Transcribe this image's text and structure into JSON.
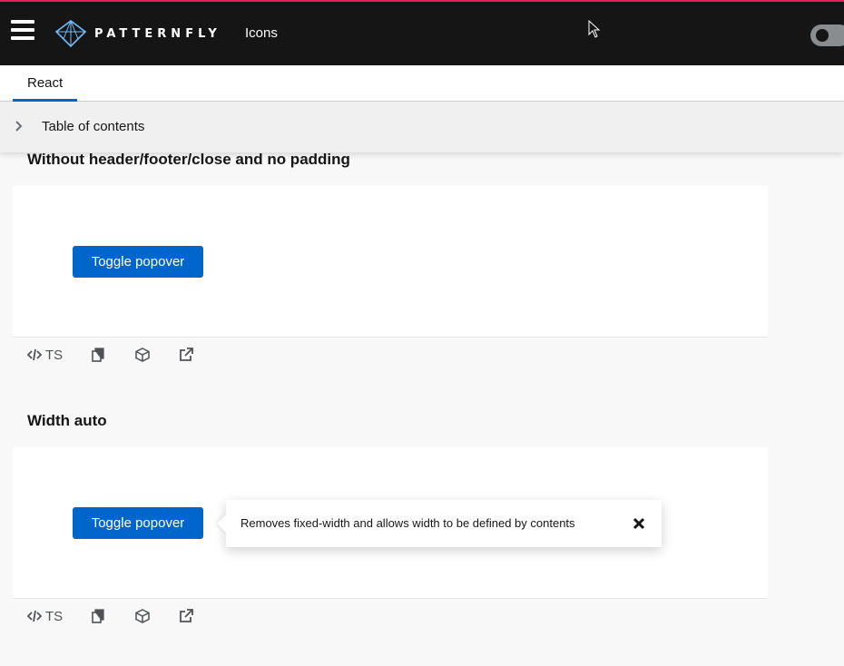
{
  "header": {
    "brand": "PATTERNFLY",
    "nav_link": "Icons",
    "menu_icon": "hamburger-icon",
    "logo_icon": "patternfly-logo-icon",
    "theme_toggle_icon": "theme-toggle"
  },
  "tabs": [
    {
      "label": "React",
      "active": true
    }
  ],
  "toc": {
    "label": "Table of contents",
    "icon": "chevron-right-icon"
  },
  "sections": [
    {
      "title": "Without header/footer/close and no padding",
      "button_label": "Toggle popover",
      "toolbar": {
        "ts_label": "TS",
        "icons": [
          "code-icon",
          "copy-icon",
          "codesandbox-icon",
          "external-link-icon"
        ]
      }
    },
    {
      "title": "Width auto",
      "button_label": "Toggle popover",
      "toolbar": {
        "ts_label": "TS",
        "icons": [
          "code-icon",
          "copy-icon",
          "codesandbox-icon",
          "external-link-icon"
        ]
      },
      "popover": {
        "body": "Removes fixed-width and allows width to be defined by contents",
        "close_icon": "close-icon"
      }
    }
  ],
  "colors": {
    "topbar": "#151515",
    "accent_line": "#e0245e",
    "primary": "#0066cc",
    "page_bg": "#f8f8f8",
    "logo": "#73bcf7"
  }
}
